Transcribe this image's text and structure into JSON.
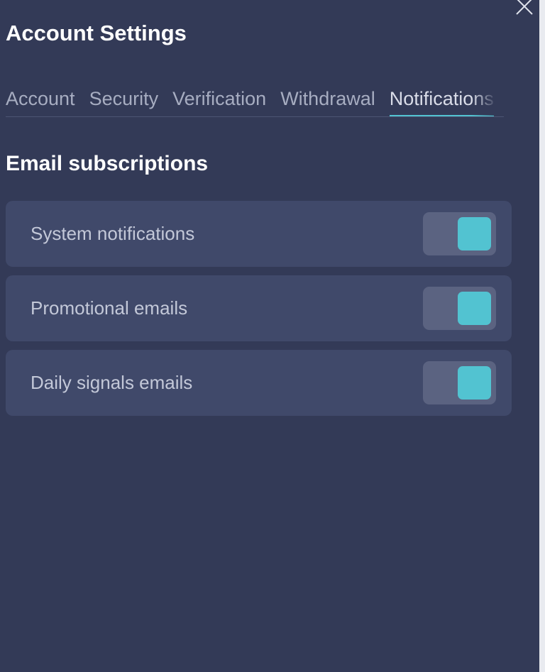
{
  "header": {
    "title": "Account Settings",
    "close_icon": "close-icon"
  },
  "tabs": [
    {
      "label": "Account",
      "active": false
    },
    {
      "label": "Security",
      "active": false
    },
    {
      "label": "Verification",
      "active": false
    },
    {
      "label": "Withdrawal",
      "active": false
    },
    {
      "label": "Notifications",
      "active": true
    }
  ],
  "section": {
    "heading": "Email subscriptions"
  },
  "subscriptions": [
    {
      "label": "System notifications",
      "enabled": true
    },
    {
      "label": "Promotional emails",
      "enabled": true
    },
    {
      "label": "Daily signals emails",
      "enabled": true
    }
  ],
  "colors": {
    "panel_background": "#333a57",
    "row_background": "#40496a",
    "toggle_track": "#5b6381",
    "accent": "#52c3d1"
  }
}
